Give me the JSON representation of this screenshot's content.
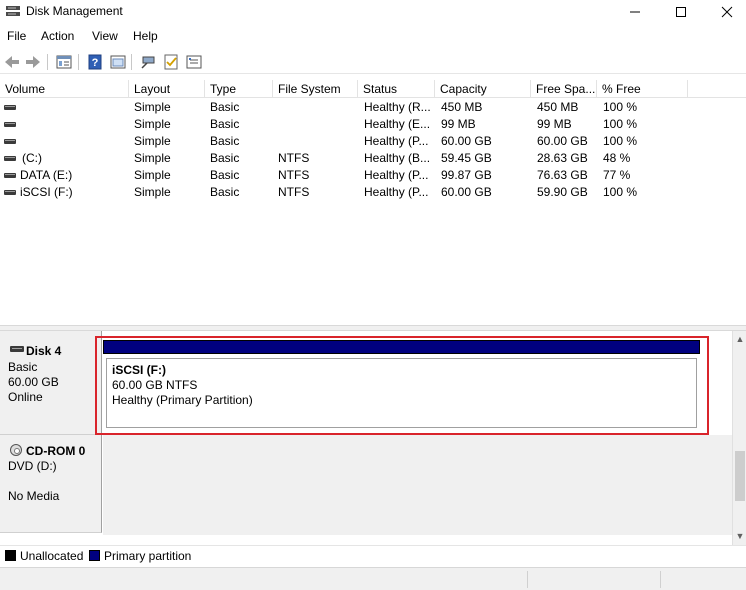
{
  "window": {
    "title": "Disk Management"
  },
  "menu": [
    "File",
    "Action",
    "View",
    "Help"
  ],
  "toolbar_icons": [
    "back-arrow-icon",
    "forward-arrow-icon",
    "properties-icon",
    "help-icon",
    "refresh-icon",
    "connect-icon",
    "check-icon",
    "rescan-icon"
  ],
  "columns": [
    "Volume",
    "Layout",
    "Type",
    "File System",
    "Status",
    "Capacity",
    "Free Spa...",
    "% Free"
  ],
  "volumes": [
    {
      "volume": "",
      "layout": "Simple",
      "type": "Basic",
      "fs": "",
      "status": "Healthy (R...",
      "capacity": "450 MB",
      "free": "450 MB",
      "pct": "100 %"
    },
    {
      "volume": "",
      "layout": "Simple",
      "type": "Basic",
      "fs": "",
      "status": "Healthy (E...",
      "capacity": "99 MB",
      "free": "99 MB",
      "pct": "100 %"
    },
    {
      "volume": "",
      "layout": "Simple",
      "type": "Basic",
      "fs": "",
      "status": "Healthy (P...",
      "capacity": "60.00 GB",
      "free": "60.00 GB",
      "pct": "100 %"
    },
    {
      "volume": "(C:)",
      "layout": "Simple",
      "type": "Basic",
      "fs": "NTFS",
      "status": "Healthy (B...",
      "capacity": "59.45 GB",
      "free": "28.63 GB",
      "pct": "48 %"
    },
    {
      "volume": "DATA (E:)",
      "layout": "Simple",
      "type": "Basic",
      "fs": "NTFS",
      "status": "Healthy (P...",
      "capacity": "99.87 GB",
      "free": "76.63 GB",
      "pct": "77 %"
    },
    {
      "volume": "iSCSI (F:)",
      "layout": "Simple",
      "type": "Basic",
      "fs": "NTFS",
      "status": "Healthy (P...",
      "capacity": "60.00 GB",
      "free": "59.90 GB",
      "pct": "100 %"
    }
  ],
  "disk4": {
    "name": "Disk 4",
    "type": "Basic",
    "size": "60.00 GB",
    "state": "Online",
    "partition": {
      "name": "iSCSI  (F:)",
      "size_fs": "60.00 GB NTFS",
      "status": "Healthy (Primary Partition)"
    }
  },
  "cdrom0": {
    "name": "CD-ROM 0",
    "drive": "DVD (D:)",
    "media": "No Media"
  },
  "legend": [
    {
      "label": "Unallocated",
      "color": "#000000"
    },
    {
      "label": "Primary partition",
      "color": "#00007f"
    }
  ],
  "colors": {
    "primary_partition": "#00007f",
    "highlight": "#d9242b"
  }
}
